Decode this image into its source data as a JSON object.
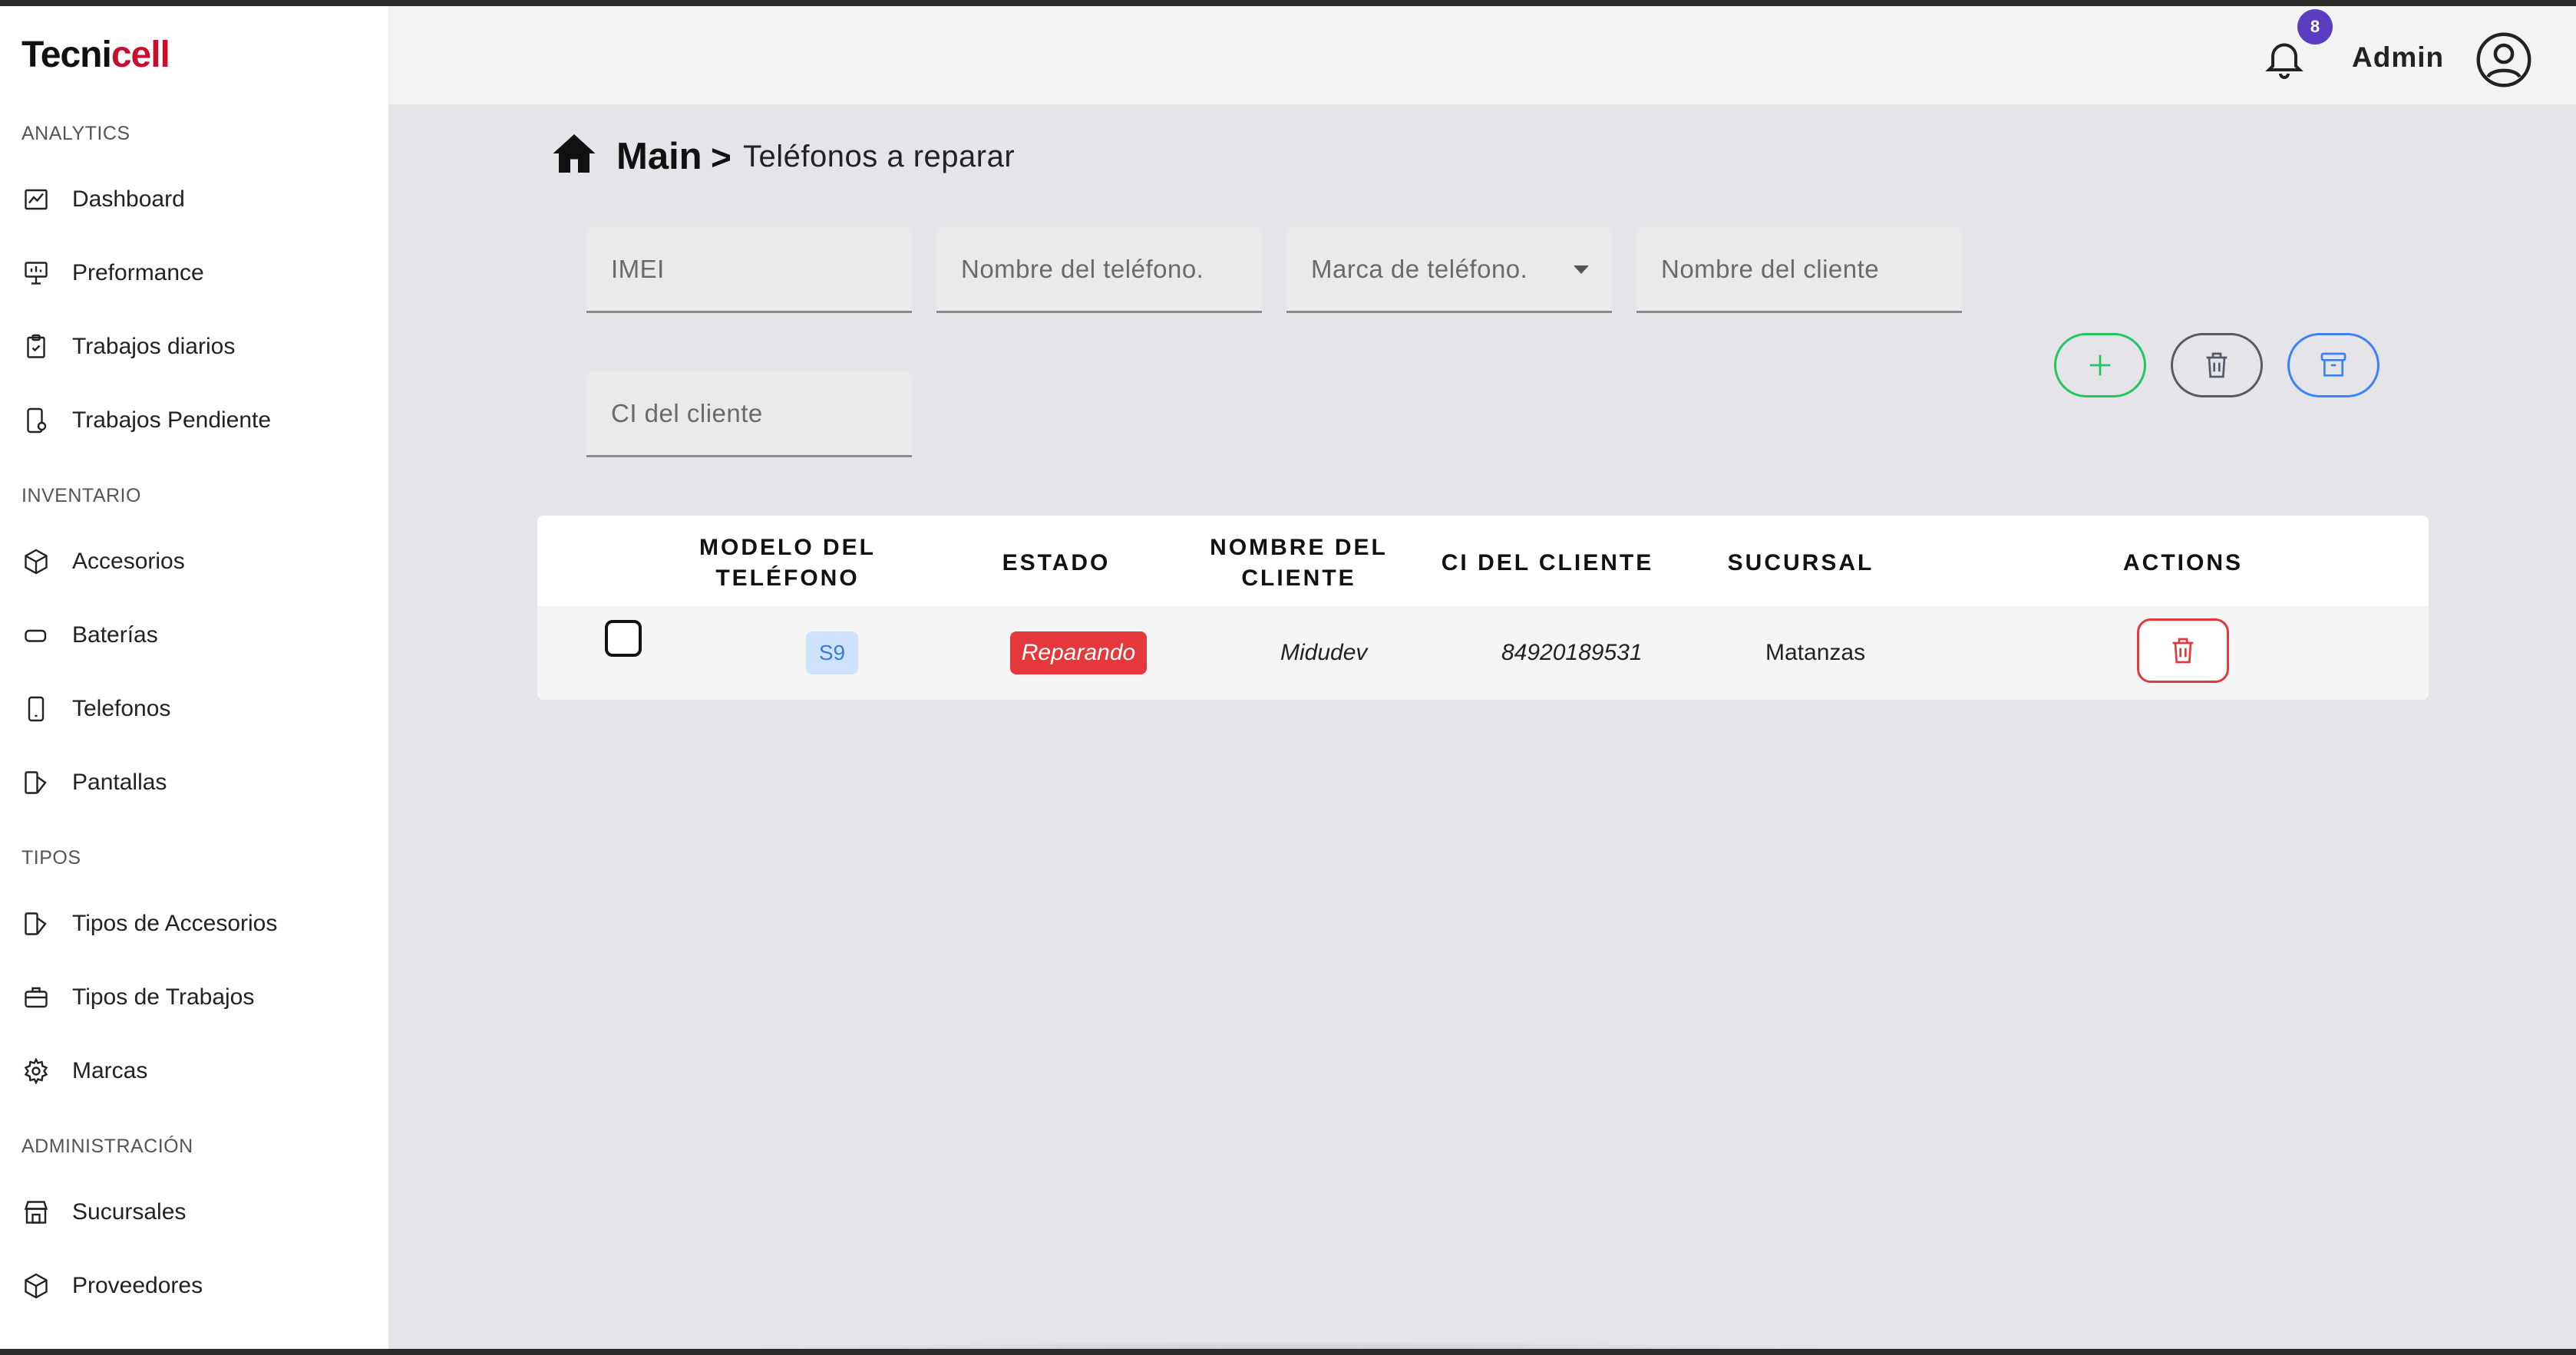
{
  "brand": {
    "part1": "Tecni",
    "part2": "cell",
    "accent_color": "#c8102e"
  },
  "sidebar": {
    "sections": [
      {
        "title": "ANALYTICS",
        "items": [
          {
            "label": "Dashboard",
            "icon": "chart-line-icon"
          },
          {
            "label": "Preformance",
            "icon": "presentation-chart-icon"
          },
          {
            "label": "Trabajos diarios",
            "icon": "clipboard-icon"
          },
          {
            "label": "Trabajos Pendiente",
            "icon": "phone-settings-icon"
          }
        ]
      },
      {
        "title": "INVENTARIO",
        "items": [
          {
            "label": "Accesorios",
            "icon": "box-icon"
          },
          {
            "label": "Baterías",
            "icon": "battery-icon"
          },
          {
            "label": "Telefonos",
            "icon": "phone-icon"
          },
          {
            "label": "Pantallas",
            "icon": "screen-icon"
          }
        ]
      },
      {
        "title": "TIPOS",
        "items": [
          {
            "label": "Tipos de Accesorios",
            "icon": "screen-icon"
          },
          {
            "label": "Tipos de Trabajos",
            "icon": "briefcase-icon"
          },
          {
            "label": "Marcas",
            "icon": "gear-icon"
          }
        ]
      },
      {
        "title": "ADMINISTRACIÓN",
        "items": [
          {
            "label": "Sucursales",
            "icon": "store-icon"
          },
          {
            "label": "Proveedores",
            "icon": "box-icon"
          }
        ]
      }
    ]
  },
  "topbar": {
    "notification_count": "8",
    "user_label": "Admin"
  },
  "breadcrumb": {
    "root": "Main",
    "separator": ">",
    "current": "Teléfonos a reparar"
  },
  "filters": {
    "imei_placeholder": "IMEI",
    "phone_name_placeholder": "Nombre del teléfono.",
    "brand_select_label": "Marca de teléfono.",
    "client_name_placeholder": "Nombre del cliente",
    "client_ci_placeholder": "CI del cliente"
  },
  "actions": {
    "add_color": "#22c55e",
    "delete_color": "#555b66",
    "archive_color": "#3b82f6"
  },
  "table": {
    "headers": [
      "MODELO DEL TELÉFONO",
      "ESTADO",
      "NOMBRE DEL CLIENTE",
      "CI DEL CLIENTE",
      "SUCURSAL",
      "ACTIONS"
    ],
    "rows": [
      {
        "model": "S9",
        "status": "Reparando",
        "client_name": "Midudev",
        "client_ci": "84920189531",
        "branch": "Matanzas"
      }
    ],
    "status_color": "#e5383b"
  }
}
